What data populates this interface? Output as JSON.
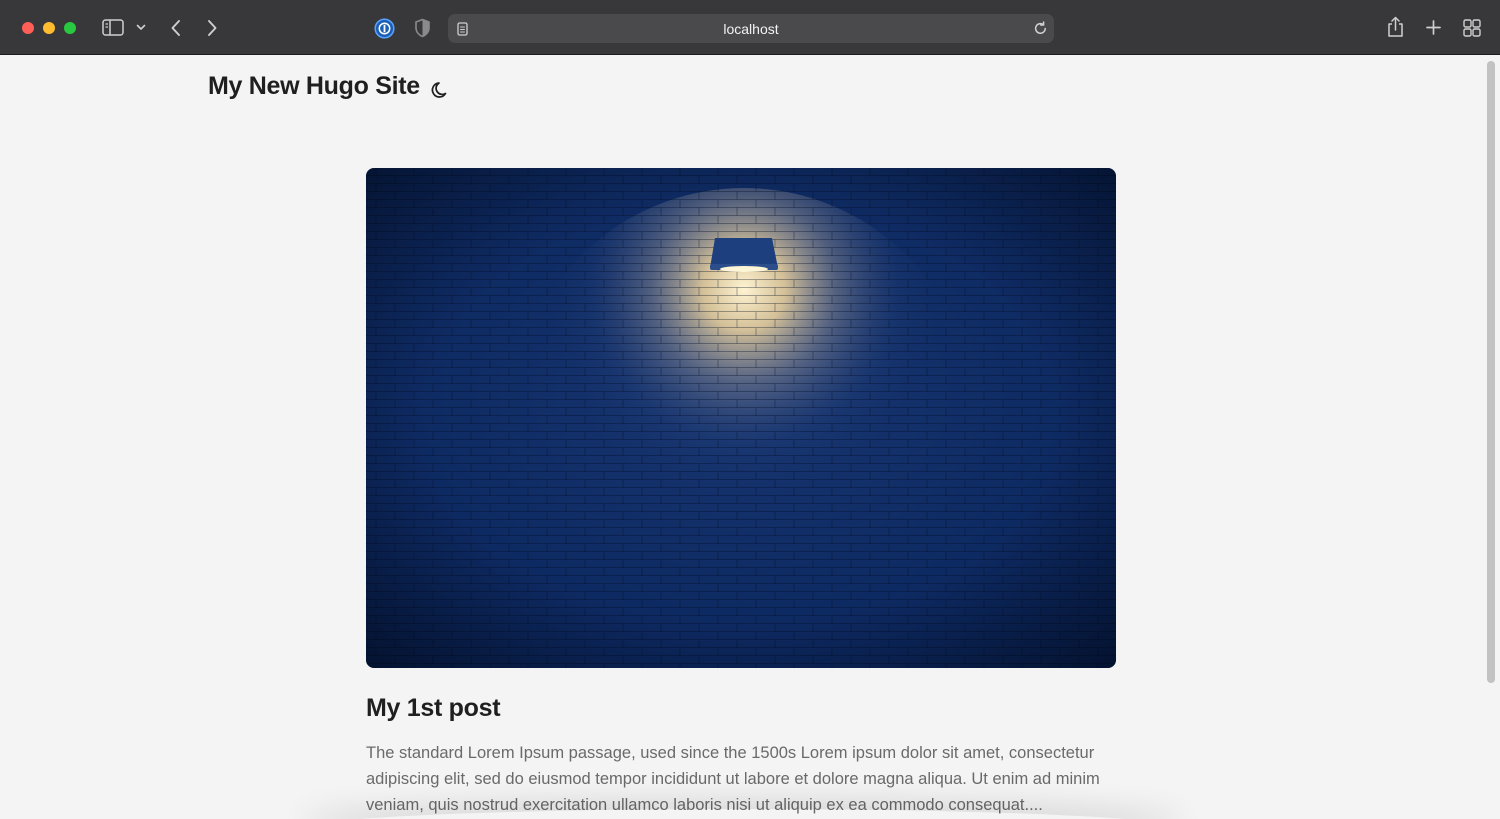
{
  "browser": {
    "url": "localhost"
  },
  "page": {
    "site_title": "My New Hugo Site",
    "post": {
      "title": "My 1st post",
      "summary": "The standard Lorem Ipsum passage, used since the 1500s Lorem ipsum dolor sit amet, consectetur adipiscing elit, sed do eiusmod tempor incididunt ut labore et dolore magna aliqua. Ut enim ad minim veniam, quis nostrud exercitation ullamco laboris nisi ut aliquip ex ea commodo consequat...."
    }
  },
  "colors": {
    "toolbar": "#38383a",
    "page_background": "#f4f4f4",
    "hero_wall": "#0f2a5e",
    "lamp_glow": "#ffe8b0"
  },
  "icons": [
    "sidebar-icon",
    "chevron-down-icon",
    "back-icon",
    "forward-icon",
    "password-manager-icon",
    "shield-icon",
    "page-icon",
    "reload-icon",
    "share-icon",
    "new-tab-icon",
    "tab-overview-icon",
    "moon-icon"
  ]
}
